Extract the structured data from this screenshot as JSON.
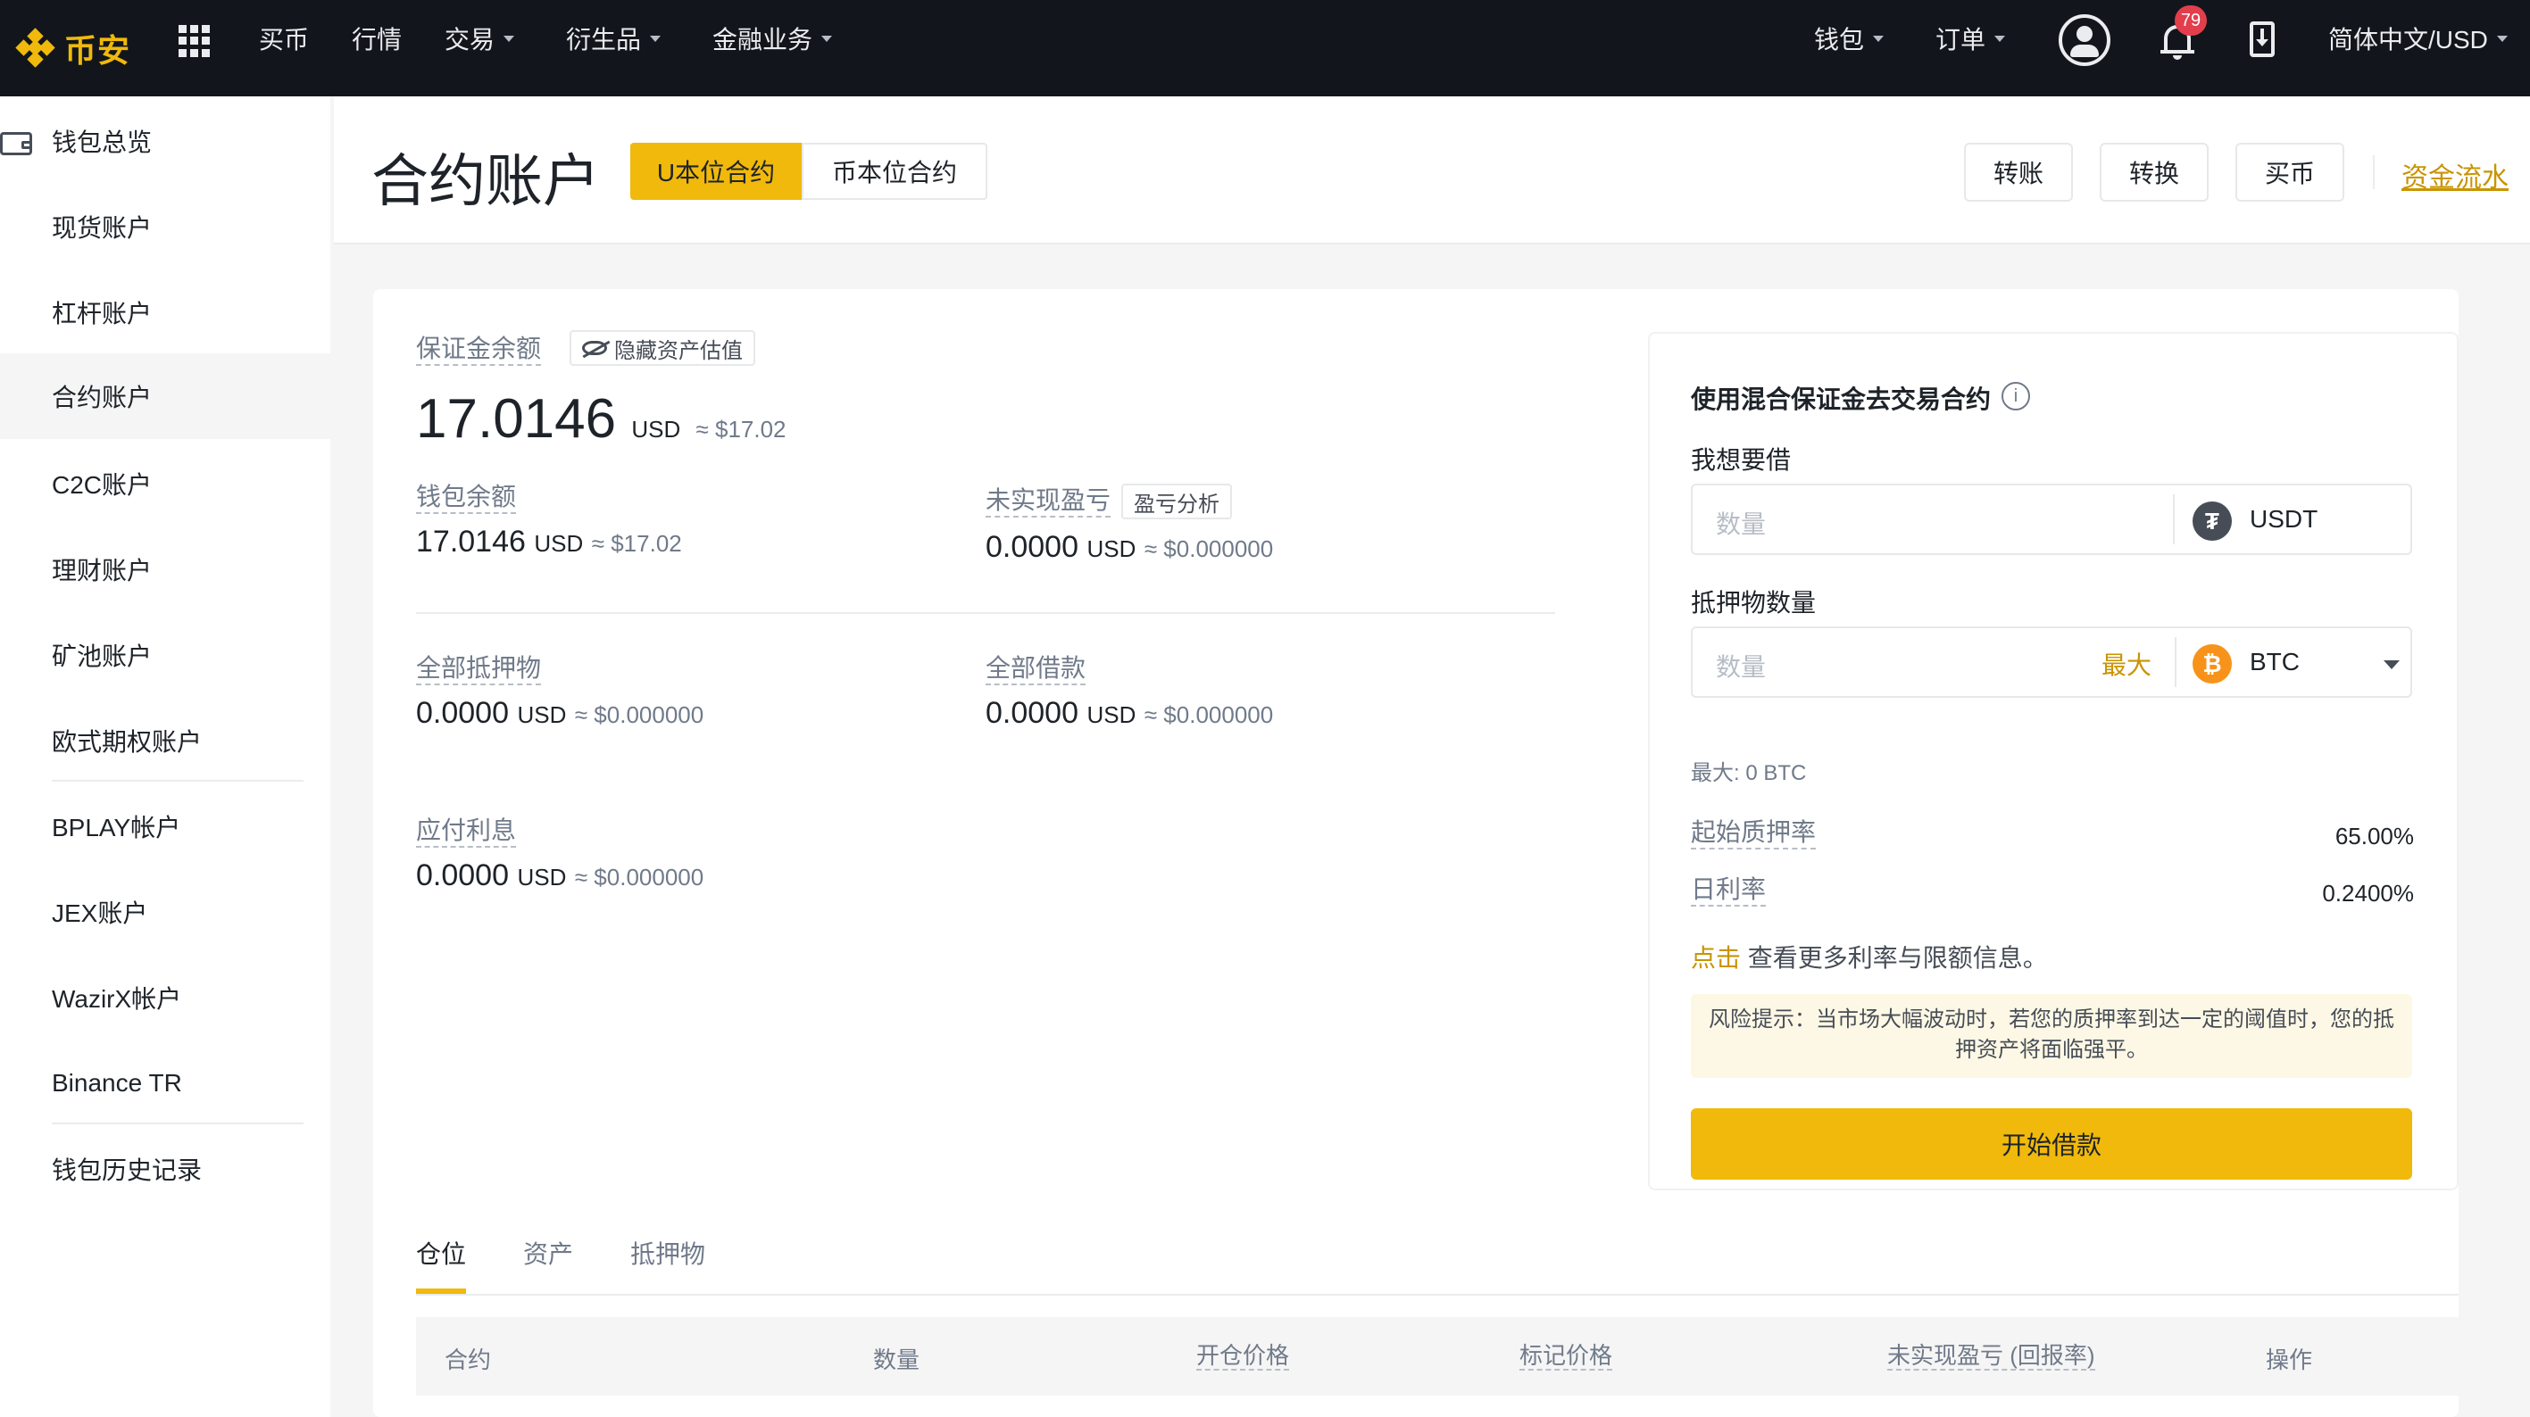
{
  "topnav": {
    "logo_text": "币安",
    "items": [
      {
        "label": "买币",
        "has_caret": false
      },
      {
        "label": "行情",
        "has_caret": false
      },
      {
        "label": "交易",
        "has_caret": true
      },
      {
        "label": "衍生品",
        "has_caret": true
      },
      {
        "label": "金融业务",
        "has_caret": true
      }
    ],
    "right": {
      "wallet": "钱包",
      "orders": "订单",
      "notification_count": "79",
      "language": "简体中文/USD"
    },
    "icons": [
      "apps-grid-icon",
      "user-icon",
      "bell-icon",
      "download-icon"
    ]
  },
  "sidebar": {
    "items": [
      {
        "label": "钱包总览"
      },
      {
        "label": "现货账户"
      },
      {
        "label": "杠杆账户"
      },
      {
        "label": "合约账户",
        "active": true
      },
      {
        "label": "C2C账户"
      },
      {
        "label": "理财账户"
      },
      {
        "label": "矿池账户"
      },
      {
        "label": "欧式期权账户"
      },
      {
        "label": "BPLAY帐户"
      },
      {
        "label": "JEX账户"
      },
      {
        "label": "WazirX帐户"
      },
      {
        "label": "Binance TR"
      },
      {
        "label": "钱包历史记录"
      }
    ]
  },
  "header": {
    "title": "合约账户",
    "segments": [
      "U本位合约",
      "币本位合约"
    ],
    "active_segment": "U本位合约",
    "buttons": [
      "转账",
      "转换",
      "买币"
    ],
    "flow_link": "资金流水"
  },
  "summary": {
    "margin_balance": {
      "label": "保证金余额",
      "value": "17.0146",
      "unit": "USD",
      "approx": "≈ $17.02",
      "hide_toggle": "隐藏资产估值"
    },
    "wallet_balance": {
      "label": "钱包余额",
      "value": "17.0146",
      "unit": "USD",
      "approx": "≈ $17.02"
    },
    "unrealized_pnl": {
      "label": "未实现盈亏",
      "value": "0.0000",
      "unit": "USD",
      "approx": "≈ $0.000000",
      "tag": "盈亏分析"
    },
    "total_collateral": {
      "label": "全部抵押物",
      "value": "0.0000",
      "unit": "USD",
      "approx": "≈ $0.000000"
    },
    "total_borrowed": {
      "label": "全部借款",
      "value": "0.0000",
      "unit": "USD",
      "approx": "≈ $0.000000"
    },
    "interest_payable": {
      "label": "应付利息",
      "value": "0.0000",
      "unit": "USD",
      "approx": "≈ $0.000000"
    }
  },
  "borrow_panel": {
    "title": "使用混合保证金去交易合约",
    "borrow_label": "我想要借",
    "borrow_placeholder": "数量",
    "borrow_coin": "USDT",
    "collateral_label": "抵押物数量",
    "collateral_placeholder": "数量",
    "max_button": "最大",
    "collateral_coin": "BTC",
    "max_note": "最大: 0 BTC",
    "initial_ltv_label": "起始质押率",
    "initial_ltv_value": "65.00%",
    "daily_rate_label": "日利率",
    "daily_rate_value": "0.2400%",
    "click_text": "点击",
    "more_info_text": "查看更多利率与限额信息。",
    "risk_warning": "风险提示：当市场大幅波动时，若您的质押率到达一定的阈值时，您的抵押资产将面临强平。",
    "submit_label": "开始借款",
    "colors": {
      "usdt": "#474d57",
      "btc": "#f7931a",
      "accent": "#f0b90b"
    }
  },
  "tabs": {
    "items": [
      "仓位",
      "资产",
      "抵押物"
    ],
    "active": "仓位"
  },
  "table": {
    "columns": [
      "合约",
      "数量",
      "开仓价格",
      "标记价格",
      "未实现盈亏 (回报率)",
      "操作"
    ]
  }
}
